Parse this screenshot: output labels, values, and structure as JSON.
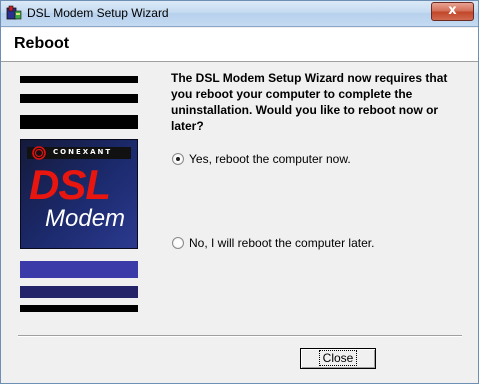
{
  "window": {
    "title": "DSL Modem Setup Wizard",
    "close_glyph": "x"
  },
  "header": {
    "title": "Reboot"
  },
  "banner": {
    "brand": "CONEXANT",
    "product_line1": "DSL",
    "product_line2": "Modem",
    "colors": {
      "stripe_dark": "#000000",
      "stripe_blue": "#3a3aa8",
      "logo_red": "#e01010"
    }
  },
  "content": {
    "message": "The DSL Modem Setup Wizard now requires that you reboot your computer to complete the uninstallation.  Would you like to reboot now or later?",
    "options": [
      {
        "label": "Yes, reboot the computer now.",
        "selected": true
      },
      {
        "label": "No, I will reboot the computer later.",
        "selected": false
      }
    ]
  },
  "footer": {
    "close_label": "Close"
  }
}
